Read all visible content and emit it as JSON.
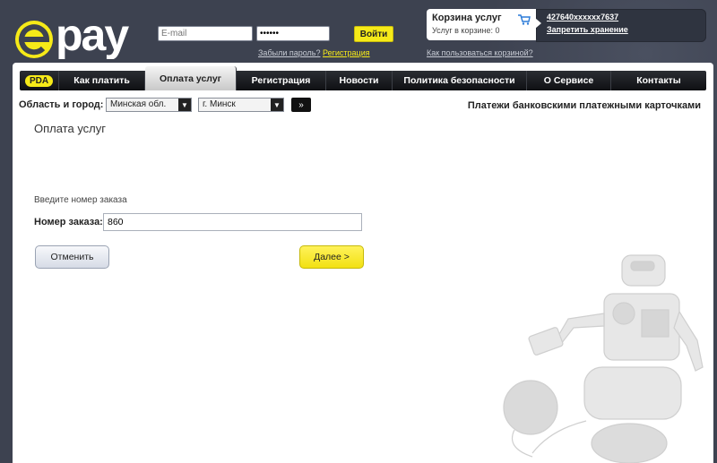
{
  "header": {
    "logo_text": "epay",
    "email_placeholder": "E-mail",
    "password_value": "••••••",
    "login_button": "Войти",
    "forgot_password": "Забыли пароль?",
    "registration_link": "Регистрация",
    "how_to_cart": "Как пользоваться корзиной?"
  },
  "cart": {
    "title": "Корзина услуг",
    "count_label": "Услуг в корзине: 0",
    "card_number": "427640xxxxxx7637",
    "forbid_storage": "Запретить хранение"
  },
  "nav": {
    "items": [
      {
        "label": "PDA"
      },
      {
        "label": "Как платить"
      },
      {
        "label": "Оплата услуг"
      },
      {
        "label": "Регистрация"
      },
      {
        "label": "Новости"
      },
      {
        "label": "Политика безопасности"
      },
      {
        "label": "О Сервисе"
      },
      {
        "label": "Контакты"
      }
    ],
    "active": "Оплата услуг"
  },
  "location": {
    "label": "Область и город:",
    "region_value": "Минская обл.",
    "city_value": "г. Минск",
    "go_button": "»",
    "cards_text": "Платежи банковскими платежными карточками"
  },
  "content": {
    "title": "Оплата услуг",
    "prompt": "Введите номер заказа",
    "order_label": "Номер заказа:",
    "order_value": "860",
    "cancel_button": "Отменить",
    "next_button": "Далее >"
  },
  "colors": {
    "accent_yellow": "#f6ea18",
    "background_dark": "#3d4250",
    "nav_dark": "#1a1c20"
  }
}
